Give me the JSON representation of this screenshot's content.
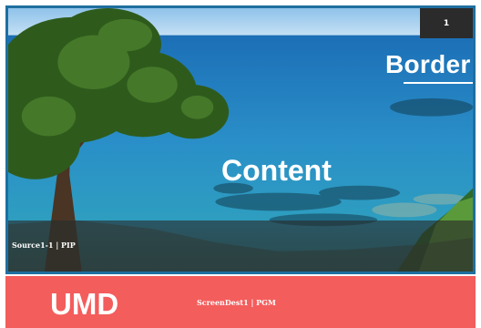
{
  "window": {
    "id_badge": "1",
    "border_label": "Border",
    "content_label": "Content",
    "source_label": "Source1-1 | PIP"
  },
  "umd": {
    "label": "UMD",
    "destination_label": "ScreenDest1 | PGM"
  },
  "colors": {
    "window_border": "#1f6fa0",
    "umd_background": "#f35d5c",
    "badge_background": "#2b2b2b"
  },
  "icons": {
    "border_indicator": "right-arrow-icon"
  }
}
